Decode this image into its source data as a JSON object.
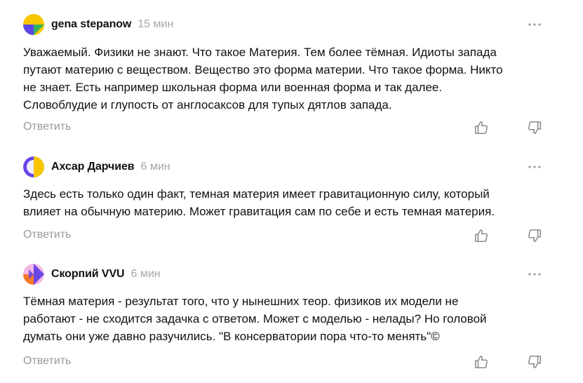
{
  "comments": [
    {
      "author": "gena stepanow",
      "time": "15 мин",
      "text": "Уважаемый. Физики не знают. Что такое Материя. Тем более тёмная. Идиоты запада\nпутают материю с веществом. Вещество это форма материи. Что такое форма. Никто\nне знает. Есть например школьная форма или военная форма и так далее.\nСловоблудие и глупость от англосаксов для тупых дятлов запада.",
      "reply": "Ответить",
      "avatar_colors": [
        "#f7c600",
        "#5b46e8",
        "#33b25a"
      ]
    },
    {
      "author": "Ахсар Дарчиев",
      "time": "6 мин",
      "text": "Здесь есть только один факт, темная материя имеет гравитационную силу, который\nвлияет на обычную материю. Может гравитация сам по себе и есть темная материя.",
      "reply": "Ответить",
      "avatar_colors": [
        "#6a45e6",
        "#f7c600",
        "#ffffff"
      ]
    },
    {
      "author": "Скорпий VVU",
      "time": "6 мин",
      "text": "Тёмная материя - результат того, что у нынешних теор. физиков их модели не\nработают - не сходится задачка с ответом. Может с моделью - нелады? Но головой\nдумать они уже давно разучились. \"В консерватории пора что-то менять\"©",
      "reply": "Ответить",
      "avatar_colors": [
        "#f47a2a",
        "#6a45e6",
        "#f5b8e6"
      ]
    }
  ]
}
